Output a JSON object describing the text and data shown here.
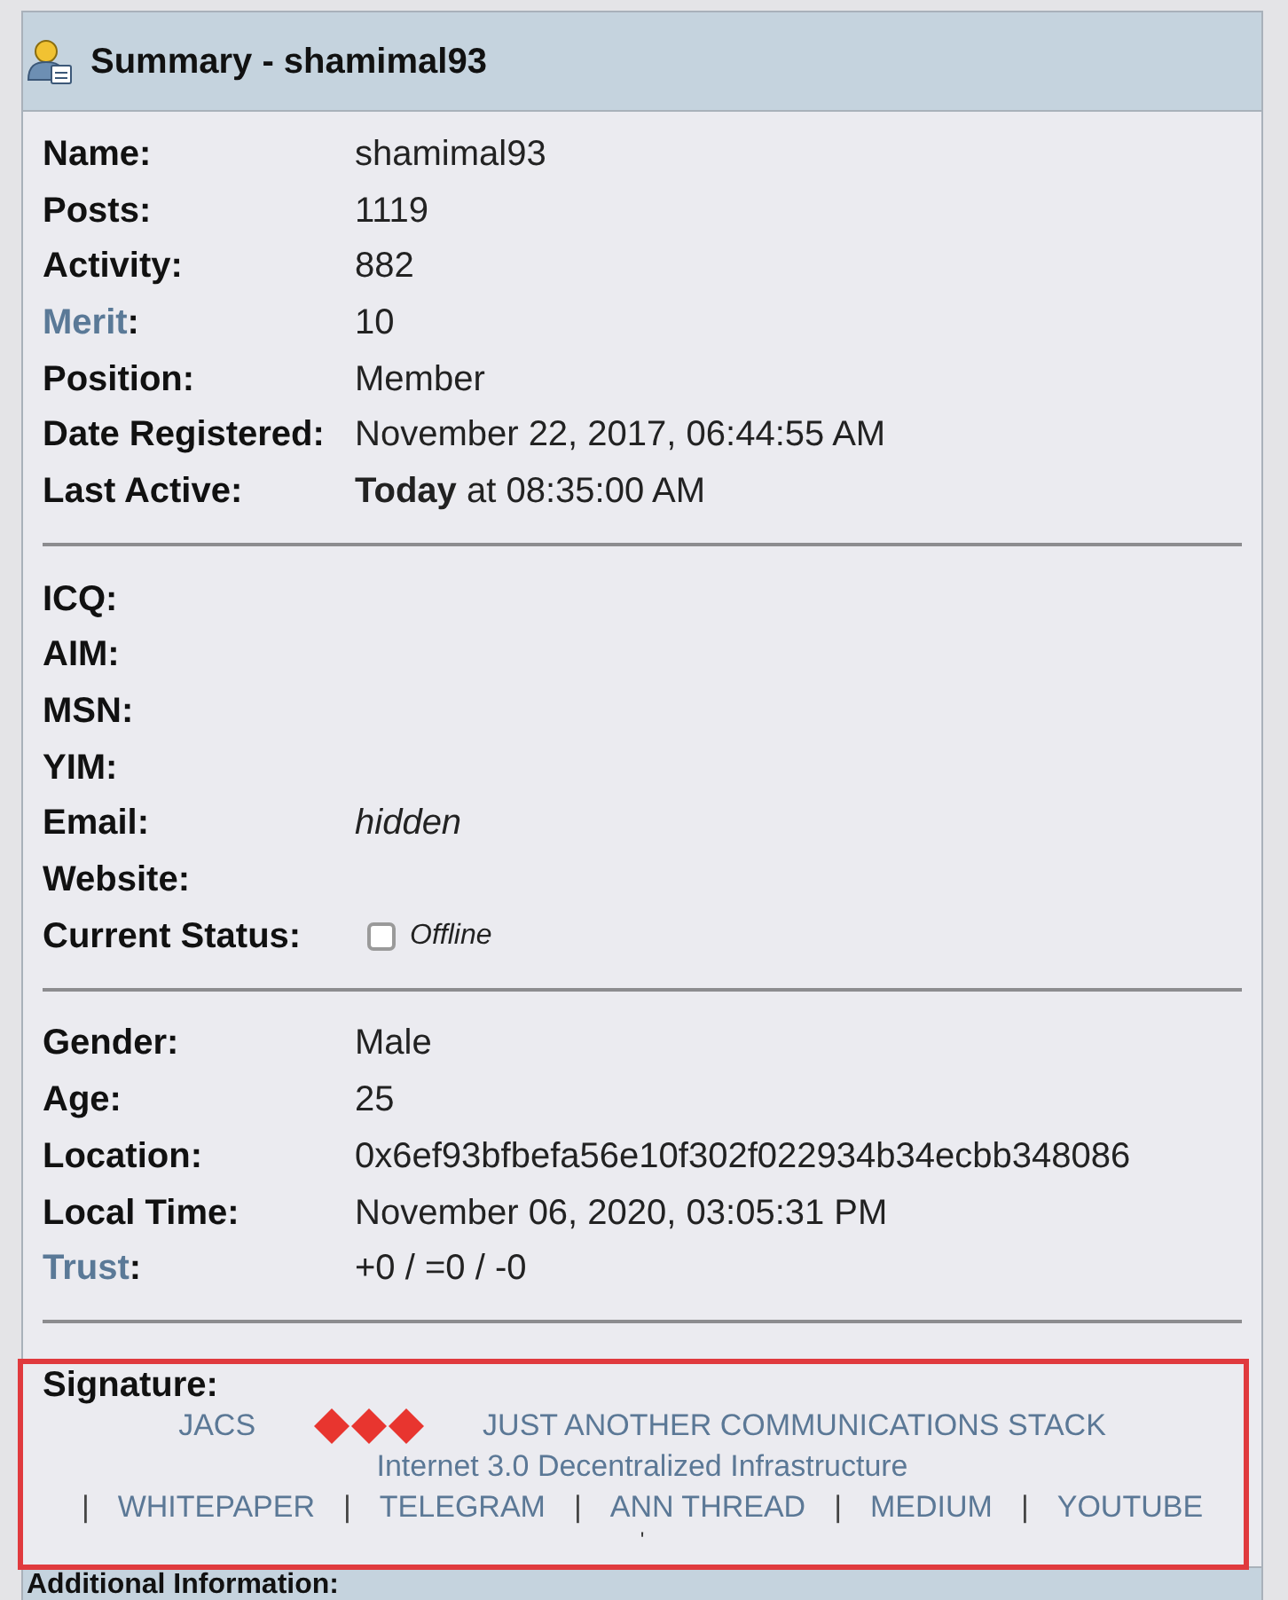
{
  "panel": {
    "title": "Summary - shamimal93"
  },
  "sections": [
    {
      "rows": [
        {
          "kind": "plain",
          "label": "Name:",
          "value": "shamimal93"
        },
        {
          "kind": "plain",
          "label": "Posts:",
          "value": "1119"
        },
        {
          "kind": "plain",
          "label": "Activity:",
          "value": "882"
        },
        {
          "kind": "link",
          "label": "Merit",
          "suffix": ":",
          "value": "10"
        },
        {
          "kind": "plain",
          "label": "Position:",
          "value": "Member"
        },
        {
          "kind": "plain",
          "label": "Date Registered:",
          "value": "November 22, 2017, 06:44:55 AM"
        },
        {
          "kind": "plain",
          "label": "Last Active:",
          "value": "**Today** at 08:35:00 AM"
        }
      ]
    },
    {
      "rows": [
        {
          "kind": "plain",
          "label": "ICQ:"
        },
        {
          "kind": "plain",
          "label": "AIM:"
        },
        {
          "kind": "plain",
          "label": "MSN:"
        },
        {
          "kind": "plain",
          "label": "YIM:"
        },
        {
          "kind": "italic",
          "label": "Email:",
          "value": "hidden"
        },
        {
          "kind": "plain",
          "label": "Website:"
        },
        {
          "kind": "status",
          "label": "Current Status:",
          "value": "Offline"
        }
      ]
    },
    {
      "rows": [
        {
          "kind": "plain",
          "label": "Gender:",
          "value": "Male"
        },
        {
          "kind": "plain",
          "label": "Age:",
          "value": "25"
        },
        {
          "kind": "plain",
          "label": "Location:",
          "value": "0x6ef93bfbefa56e10f302f022934b34ecbb348086"
        },
        {
          "kind": "plain",
          "label": "Local Time:",
          "value": "November 06, 2020, 03:05:31 PM"
        },
        {
          "kind": "link",
          "label": "Trust",
          "suffix": ":",
          "value": "+0 / =0 / -0"
        }
      ]
    }
  ],
  "signature": {
    "label": "Signature:",
    "highlighted": true,
    "lines": [
      [
        {
          "kind": "link",
          "text": "JACS"
        },
        {
          "kind": "diamond"
        },
        {
          "kind": "diamond"
        },
        {
          "kind": "diamond"
        },
        {
          "kind": "link",
          "text": "JUST ANOTHER COMMUNICATIONS STACK"
        }
      ],
      [
        {
          "kind": "link",
          "text": "Internet 3.0 Decentralized Infrastructure"
        }
      ],
      [
        {
          "kind": "separator",
          "text": "|"
        },
        {
          "kind": "link",
          "text": "WHITEPAPER"
        },
        {
          "kind": "separator",
          "text": "|"
        },
        {
          "kind": "link",
          "text": "TELEGRAM"
        },
        {
          "kind": "separator",
          "text": "|"
        },
        {
          "kind": "link",
          "text": "ANN THREAD"
        },
        {
          "kind": "separator",
          "text": "|"
        },
        {
          "kind": "link",
          "text": "MEDIUM"
        },
        {
          "kind": "separator",
          "text": "|"
        },
        {
          "kind": "link",
          "text": "YOUTUBE"
        }
      ],
      [
        {
          "kind": "text",
          "text": "'"
        }
      ]
    ]
  },
  "next_section": {
    "title": "Additional Information:"
  }
}
